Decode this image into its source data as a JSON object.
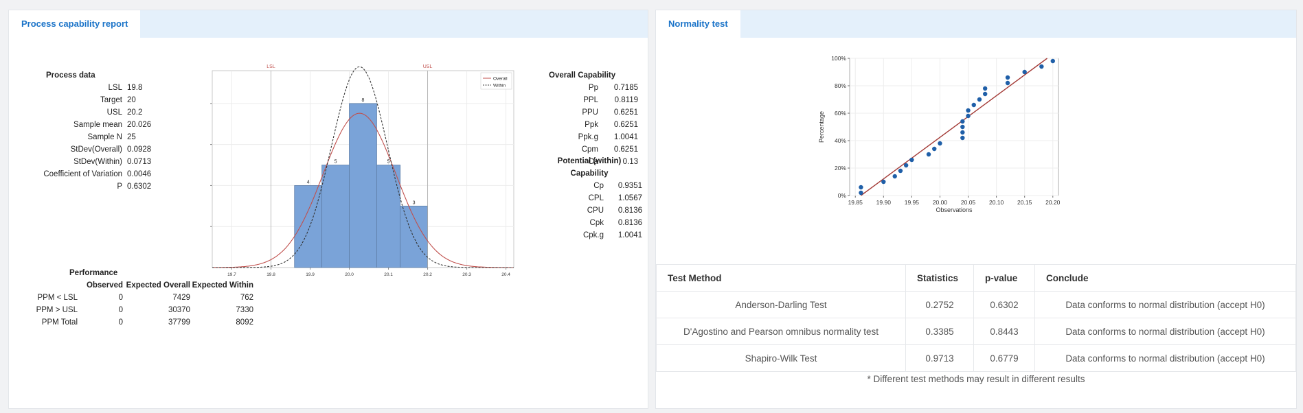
{
  "left_panel": {
    "tab_label": "Process capability report",
    "process_data": {
      "heading": "Process data",
      "rows": [
        {
          "label": "LSL",
          "value": "19.8"
        },
        {
          "label": "Target",
          "value": "20"
        },
        {
          "label": "USL",
          "value": "20.2"
        },
        {
          "label": "Sample mean",
          "value": "20.026"
        },
        {
          "label": "Sample N",
          "value": "25"
        },
        {
          "label": "StDev(Overall)",
          "value": "0.0928"
        },
        {
          "label": "StDev(Within)",
          "value": "0.0713"
        },
        {
          "label": "Coefficient of Variation",
          "value": "0.0046"
        },
        {
          "label": "P",
          "value": "0.6302"
        }
      ]
    },
    "overall_capability": {
      "heading": "Overall Capability",
      "rows": [
        {
          "label": "Pp",
          "value": "0.7185"
        },
        {
          "label": "PPL",
          "value": "0.8119"
        },
        {
          "label": "PPU",
          "value": "0.6251"
        },
        {
          "label": "Ppk",
          "value": "0.6251"
        },
        {
          "label": "Ppk.g",
          "value": "1.0041"
        },
        {
          "label": "Cpm",
          "value": "0.6251"
        },
        {
          "label": "Ca",
          "value": "0.13"
        }
      ]
    },
    "potential_within": {
      "heading_line1": "Potential (within)",
      "heading_line2": "Capability",
      "rows": [
        {
          "label": "Cp",
          "value": "0.9351"
        },
        {
          "label": "CPL",
          "value": "1.0567"
        },
        {
          "label": "CPU",
          "value": "0.8136"
        },
        {
          "label": "Cpk",
          "value": "0.8136"
        },
        {
          "label": "Cpk.g",
          "value": "1.0041"
        }
      ]
    },
    "performance": {
      "heading": "Performance",
      "columns": [
        "",
        "Observed",
        "Expected Overall",
        "Expected Within"
      ],
      "rows": [
        {
          "label": "PPM < LSL",
          "observed": "0",
          "expected_overall": "7429",
          "expected_within": "762"
        },
        {
          "label": "PPM > USL",
          "observed": "0",
          "expected_overall": "30370",
          "expected_within": "7330"
        },
        {
          "label": "PPM Total",
          "observed": "0",
          "expected_overall": "37799",
          "expected_within": "8092"
        }
      ]
    }
  },
  "right_panel": {
    "tab_label": "Normality test",
    "table": {
      "headers": [
        "Test Method",
        "Statistics",
        "p-value",
        "Conclude"
      ],
      "rows": [
        {
          "method": "Anderson-Darling Test",
          "statistics": "0.2752",
          "p_value": "0.6302",
          "conclude": "Data conforms to normal distribution (accept H0)"
        },
        {
          "method": "D'Agostino and Pearson omnibus normality test",
          "statistics": "0.3385",
          "p_value": "0.8443",
          "conclude": "Data conforms to normal distribution (accept H0)"
        },
        {
          "method": "Shapiro-Wilk Test",
          "statistics": "0.9713",
          "p_value": "0.6779",
          "conclude": "Data conforms to normal distribution (accept H0)"
        }
      ]
    },
    "footnote": "* Different test methods may result in different results"
  },
  "colors": {
    "accent": "#1a73c8",
    "tab_bar": "#e4f0fb",
    "bar_fill": "#7aa3d8",
    "overall_curve": "#c0504d",
    "within_curve": "#333333",
    "spec_line": "#c0504d",
    "point": "#1f5fa8",
    "ref_line": "#a33a36"
  },
  "chart_data": [
    {
      "type": "bar",
      "subtype": "histogram",
      "bins": [
        {
          "x0": 19.86,
          "x1": 19.93,
          "count": 4
        },
        {
          "x0": 19.93,
          "x1": 20.0,
          "count": 5
        },
        {
          "x0": 20.0,
          "x1": 20.07,
          "count": 8
        },
        {
          "x0": 20.07,
          "x1": 20.13,
          "count": 5
        },
        {
          "x0": 20.13,
          "x1": 20.2,
          "count": 3
        }
      ],
      "xticks": [
        "19.7",
        "19.8",
        "19.9",
        "20.0",
        "20.1",
        "20.2",
        "20.3",
        "20.4"
      ],
      "xlim": [
        19.65,
        20.42
      ],
      "ylim": [
        0,
        9.6
      ],
      "spec_lines": [
        {
          "label": "LSL",
          "x": 19.8
        },
        {
          "label": "USL",
          "x": 20.2
        }
      ],
      "curves": [
        {
          "name": "Overall",
          "mean": 20.026,
          "sd": 0.0928,
          "style": "solid"
        },
        {
          "name": "Within",
          "mean": 20.026,
          "sd": 0.0713,
          "style": "dashed"
        }
      ],
      "legend_position": "top-right",
      "grid": true
    },
    {
      "type": "scatter",
      "subtype": "normal probability plot",
      "xlabel": "Observations",
      "ylabel": "Percentage",
      "xticks": [
        "19.85",
        "19.90",
        "19.95",
        "20.00",
        "20.05",
        "20.10",
        "20.15",
        "20.20"
      ],
      "yticks": [
        "0%",
        "20%",
        "40%",
        "60%",
        "80%",
        "100%"
      ],
      "xlim": [
        19.84,
        20.21
      ],
      "ylim": [
        0,
        100
      ],
      "points": [
        {
          "x": 19.86,
          "y": 2
        },
        {
          "x": 19.86,
          "y": 6
        },
        {
          "x": 19.9,
          "y": 10
        },
        {
          "x": 19.92,
          "y": 14
        },
        {
          "x": 19.93,
          "y": 18
        },
        {
          "x": 19.94,
          "y": 22
        },
        {
          "x": 19.95,
          "y": 26
        },
        {
          "x": 19.98,
          "y": 30
        },
        {
          "x": 19.99,
          "y": 34
        },
        {
          "x": 20.0,
          "y": 38
        },
        {
          "x": 20.04,
          "y": 42
        },
        {
          "x": 20.04,
          "y": 46
        },
        {
          "x": 20.04,
          "y": 50
        },
        {
          "x": 20.04,
          "y": 54
        },
        {
          "x": 20.05,
          "y": 58
        },
        {
          "x": 20.05,
          "y": 62
        },
        {
          "x": 20.06,
          "y": 66
        },
        {
          "x": 20.07,
          "y": 70
        },
        {
          "x": 20.08,
          "y": 74
        },
        {
          "x": 20.08,
          "y": 78
        },
        {
          "x": 20.12,
          "y": 82
        },
        {
          "x": 20.12,
          "y": 86
        },
        {
          "x": 20.15,
          "y": 90
        },
        {
          "x": 20.18,
          "y": 94
        },
        {
          "x": 20.2,
          "y": 98
        }
      ],
      "reference_line": [
        {
          "x": 19.86,
          "y": 0
        },
        {
          "x": 20.19,
          "y": 100
        }
      ],
      "grid": true
    }
  ]
}
